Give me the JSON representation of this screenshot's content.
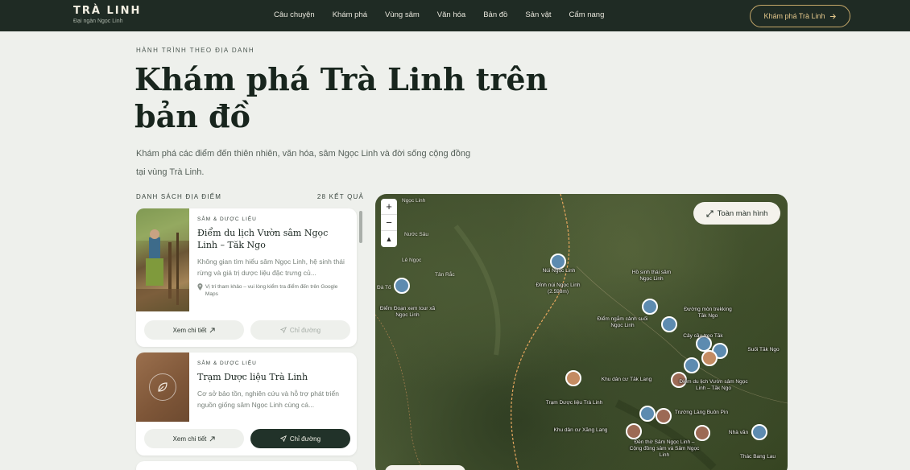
{
  "brand": {
    "name": "TRÀ LINH",
    "subtitle": "Đại ngàn Ngọc Linh"
  },
  "nav": {
    "items": [
      "Câu chuyện",
      "Khám phá",
      "Vùng sâm",
      "Văn hóa",
      "Bản đồ",
      "Sản vật",
      "Cẩm nang"
    ],
    "cta_label": "Khám phá Trà Linh",
    "cta_icon": "arrow-right-icon"
  },
  "hero": {
    "eyebrow": "HÀNH TRÌNH THEO ĐỊA DANH",
    "title": "Khám phá Trà Linh trên bản đồ",
    "description": "Khám phá các điểm đến thiên nhiên, văn hóa, sâm Ngọc Linh và đời sống cộng đồng tại vùng Trà Linh."
  },
  "list": {
    "heading": "DANH SÁCH ĐỊA ĐIỂM",
    "count": "28 KẾT QUẢ",
    "cards": [
      {
        "category": "SÂM & DƯỢC LIỆU",
        "title": "Điểm du lịch Vườn sâm Ngọc Linh – Tăk Ngo",
        "description": "Không gian tìm hiểu sâm Ngọc Linh, hệ sinh thái rừng và giá trị dược liệu đặc trưng củ...",
        "note": "Vị trí tham khảo – vui lòng kiểm tra điểm đến trên Google Maps",
        "detail_label": "Xem chi tiết",
        "directions_label": "Chỉ đường"
      },
      {
        "category": "SÂM & DƯỢC LIỆU",
        "title": "Trạm Dược liệu Trà Linh",
        "description": "Cơ sở bảo tồn, nghiên cứu và hỗ trợ phát triển nguồn giống sâm Ngọc Linh cùng cá...",
        "detail_label": "Xem chi tiết",
        "directions_label": "Chỉ đường"
      }
    ]
  },
  "map": {
    "zoom_in": "+",
    "zoom_out": "−",
    "compass": "▲",
    "fullscreen_label": "Toàn màn hình",
    "places": [
      "Ngọc Linh",
      "Nước Sâu",
      "Tân Rắc",
      "Lê Ngọc",
      "Đà Tố"
    ],
    "labels": [
      "Núi Ngọc Linh",
      "Đỉnh núi Ngọc Linh (2.598m)",
      "Hồ sinh thái sâm Ngọc Linh",
      "Điểm ngắm cảnh suối Ngọc Linh",
      "Đường mòn trekking Tăk Ngo",
      "Điểm Đoạn xem tour xã Ngọc Linh",
      "Cây cầu treo Tăk",
      "Suối Tăk Ngo",
      "Khu dân cư Tăk Lang",
      "Điểm du lịch Vườn sâm Ngọc Linh – Tăk Ngo",
      "Trạm Dược liệu Trà Linh",
      "Khu dân cư Xăng Lang",
      "Trường Làng Buôn Pin",
      "Đền thờ Sâm Ngọc Linh – Cộng đồng sâm và Sâm Ngọc Linh",
      "Thác Bang Lau",
      "Nhà văn"
    ]
  }
}
